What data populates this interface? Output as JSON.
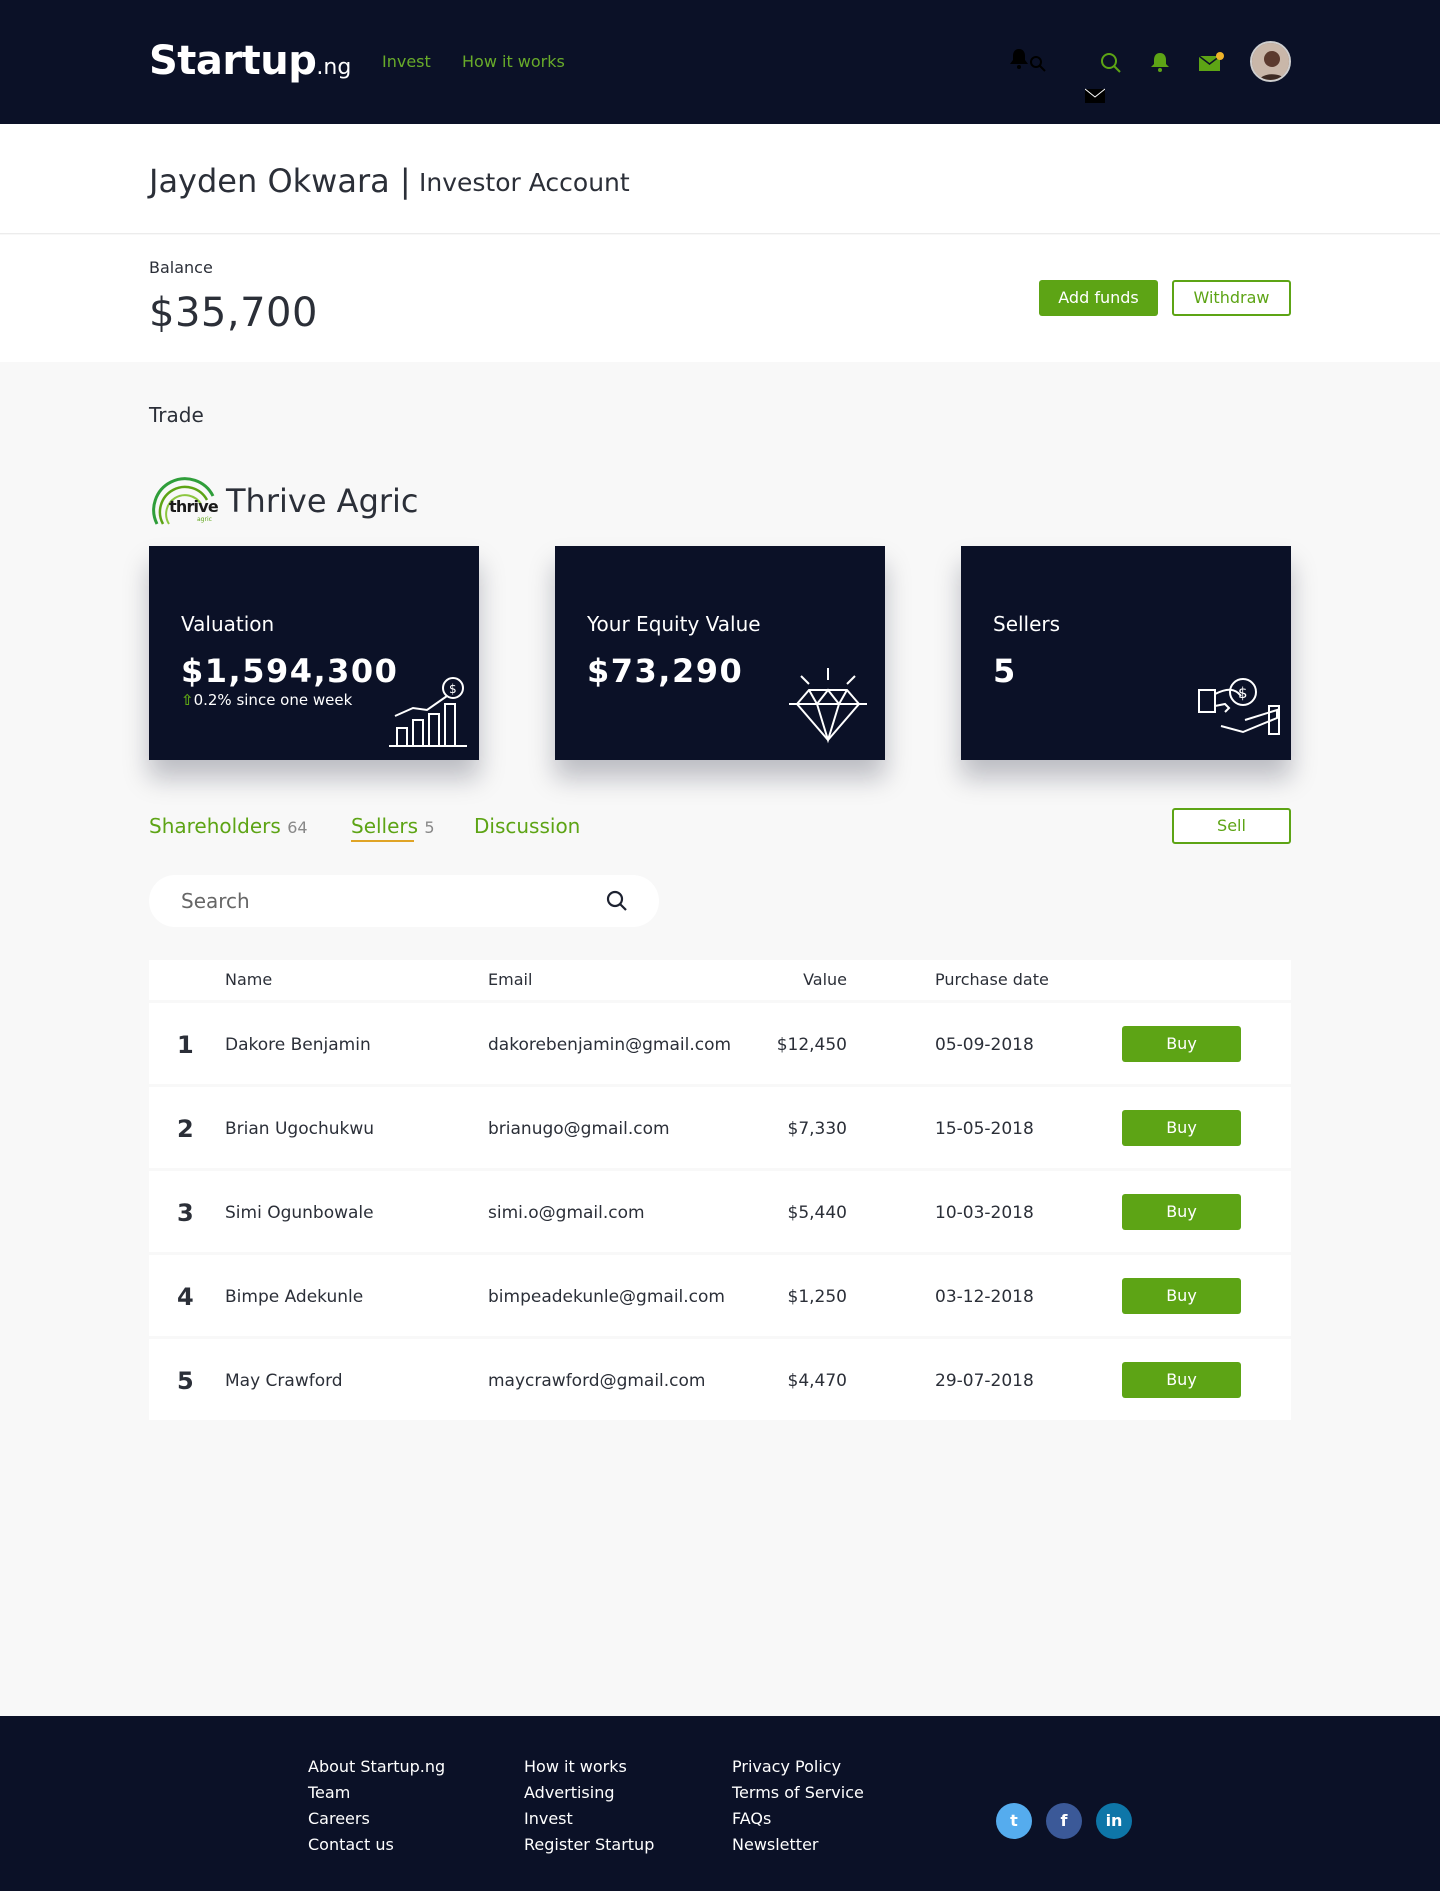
{
  "header": {
    "logo_main": "Startup",
    "logo_suffix": ".ng",
    "nav": [
      "Invest",
      "How it works"
    ],
    "icons": [
      "bell-icon",
      "search-icon",
      "search-icon",
      "bell-icon",
      "mail-icon",
      "mail-icon"
    ],
    "accent": "#68ab2a"
  },
  "account": {
    "name": "Jayden Okwara",
    "separator": "|",
    "type": "Investor Account"
  },
  "balance": {
    "label": "Balance",
    "value": "$35,700",
    "add_funds": "Add funds",
    "withdraw": "Withdraw"
  },
  "trade": {
    "title": "Trade",
    "company": "Thrive Agric",
    "company_logo_text": "thrive",
    "company_logo_sub": "agric"
  },
  "cards": [
    {
      "label": "Valuation",
      "value": "$1,594,300",
      "sub_arrow": "⇧",
      "sub": "0.2% since one week",
      "icon": "growth-chart-icon"
    },
    {
      "label": "Your Equity Value",
      "value": "$73,290",
      "icon": "diamond-icon"
    },
    {
      "label": "Sellers",
      "value": "5",
      "icon": "hand-coin-icon"
    }
  ],
  "tabs": [
    {
      "label": "Shareholders",
      "count": "64"
    },
    {
      "label": "Sellers",
      "count": "5"
    },
    {
      "label": "Discussion",
      "count": ""
    }
  ],
  "sell_label": "Sell",
  "search": {
    "placeholder": "Search"
  },
  "table": {
    "headers": [
      "Name",
      "Email",
      "Value",
      "Purchase date"
    ],
    "buy_label": "Buy",
    "rows": [
      {
        "num": "1",
        "name": "Dakore Benjamin",
        "email": "dakorebenjamin@gmail.com",
        "value": "$12,450",
        "date": "05-09-2018"
      },
      {
        "num": "2",
        "name": "Brian Ugochukwu",
        "email": "brianugo@gmail.com",
        "value": "$7,330",
        "date": "15-05-2018"
      },
      {
        "num": "3",
        "name": "Simi Ogunbowale",
        "email": "simi.o@gmail.com",
        "value": "$5,440",
        "date": "10-03-2018"
      },
      {
        "num": "4",
        "name": "Bimpe Adekunle",
        "email": "bimpeadekunle@gmail.com",
        "value": "$1,250",
        "date": "03-12-2018"
      },
      {
        "num": "5",
        "name": "May Crawford",
        "email": "maycrawford@gmail.com",
        "value": "$4,470",
        "date": "29-07-2018"
      }
    ]
  },
  "footer": {
    "col1": [
      "About Startup.ng",
      "Team",
      "Careers",
      "Contact us"
    ],
    "col2": [
      "How it works",
      "Advertising",
      "Invest",
      "Register Startup"
    ],
    "col3": [
      "Privacy Policy",
      "Terms of Service",
      "FAQs",
      "Newsletter"
    ],
    "social": [
      {
        "icon": "twitter-icon",
        "glyph": "t",
        "color": "#55acee"
      },
      {
        "icon": "facebook-icon",
        "glyph": "f",
        "color": "#3b5998"
      },
      {
        "icon": "linkedin-icon",
        "glyph": "in",
        "color": "#0e76a8"
      }
    ]
  }
}
